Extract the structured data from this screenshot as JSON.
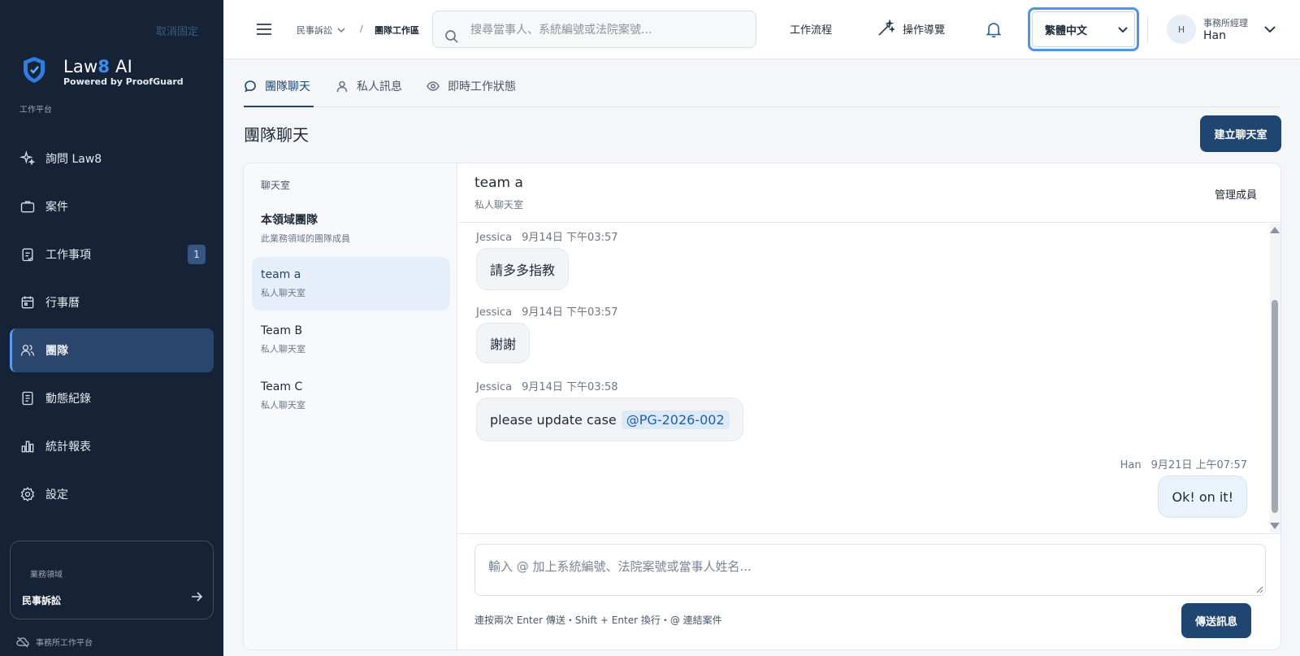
{
  "sidebar": {
    "unpin_label": "取消固定",
    "brand_prefix": "Law",
    "brand_eight": "8",
    "brand_suffix": " AI",
    "brand_sub": "Powered by ProofGuard",
    "platform_label": "工作平台",
    "items": [
      {
        "label": "詢問 Law8",
        "icon": "sparkle-icon"
      },
      {
        "label": "案件",
        "icon": "briefcase-icon"
      },
      {
        "label": "工作事項",
        "icon": "clipboard-icon",
        "badge": "1"
      },
      {
        "label": "行事曆",
        "icon": "calendar-icon"
      },
      {
        "label": "團隊",
        "icon": "users-icon",
        "active": true
      },
      {
        "label": "動態紀錄",
        "icon": "document-icon"
      },
      {
        "label": "統計報表",
        "icon": "bar-chart-icon"
      },
      {
        "label": "設定",
        "icon": "gear-icon"
      }
    ],
    "domain_label": "業務領域",
    "domain_value": "民事訴訟",
    "footer_label": "事務所工作平台"
  },
  "header": {
    "breadcrumb_1": "民事訴訟",
    "breadcrumb_sep": "/",
    "breadcrumb_2": "團隊工作區",
    "search_placeholder": "搜尋當事人、系統編號或法院案號...",
    "workflow_label": "工作流程",
    "guide_label": "操作導覽",
    "language": "繁體中文",
    "user_initial": "H",
    "user_role": "事務所經理",
    "user_name": "Han"
  },
  "tabs": [
    {
      "label": "團隊聊天",
      "active": true
    },
    {
      "label": "私人訊息"
    },
    {
      "label": "即時工作狀態"
    }
  ],
  "page": {
    "title": "團隊聊天",
    "create_button": "建立聊天室"
  },
  "rooms": {
    "header": "聊天室",
    "list": [
      {
        "name": "本領域團隊",
        "sub": "此業務領域的團隊成員"
      },
      {
        "name": "team a",
        "sub": "私人聊天室",
        "active": true
      },
      {
        "name": "Team B",
        "sub": "私人聊天室"
      },
      {
        "name": "Team C",
        "sub": "私人聊天室"
      }
    ]
  },
  "chat": {
    "title": "team a",
    "subtitle": "私人聊天室",
    "manage_label": "管理成員",
    "messages": [
      {
        "author": "Jessica",
        "time": "9月14日 下午03:57",
        "text": "請多多指教"
      },
      {
        "author": "Jessica",
        "time": "9月14日 下午03:57",
        "text": "謝謝"
      },
      {
        "author": "Jessica",
        "time": "9月14日 下午03:58",
        "text": "please update case",
        "mention": "@PG-2026-002"
      },
      {
        "author": "Han",
        "time": "9月21日 上午07:57",
        "text": "Ok! on it!",
        "mine": true
      }
    ],
    "composer_placeholder": "輸入 @ 加上系統編號、法院案號或當事人姓名...",
    "hint": "連按兩次 Enter 傳送・Shift + Enter 換行・@ 連結案件",
    "send_label": "傳送訊息"
  },
  "colors": {
    "sidebar_bg": "#162235",
    "accent": "#1f4670",
    "active_nav": "#2b466c",
    "focus_ring": "#4a97ec"
  }
}
